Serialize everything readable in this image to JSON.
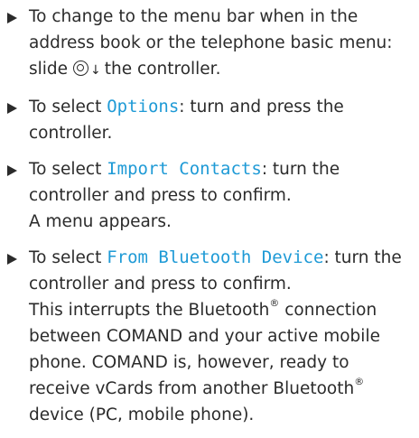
{
  "steps": [
    {
      "line1": "To change to the menu bar when in the address book or the telephone basic menu: slide",
      "icon": "controller-slide-down-icon",
      "line2": "the controller."
    },
    {
      "pre": "To select ",
      "term": "Options",
      "post": ": turn and press the controller."
    },
    {
      "pre": "To select ",
      "term": "Import Contacts",
      "post": ": turn the controller and press to confirm.",
      "result": "A menu appears."
    },
    {
      "pre": "To select ",
      "term": "From Bluetooth Device",
      "post": ": turn the controller and press to confirm.",
      "result_a": "This interrupts the Bluetooth",
      "reg": "®",
      "result_b": " connection between COMAND and your active mobile phone. COMAND is, however, ready to receive vCards from another Bluetooth",
      "result_c": " device (PC, mobile phone)."
    }
  ],
  "down_arrow_glyph": "↓"
}
